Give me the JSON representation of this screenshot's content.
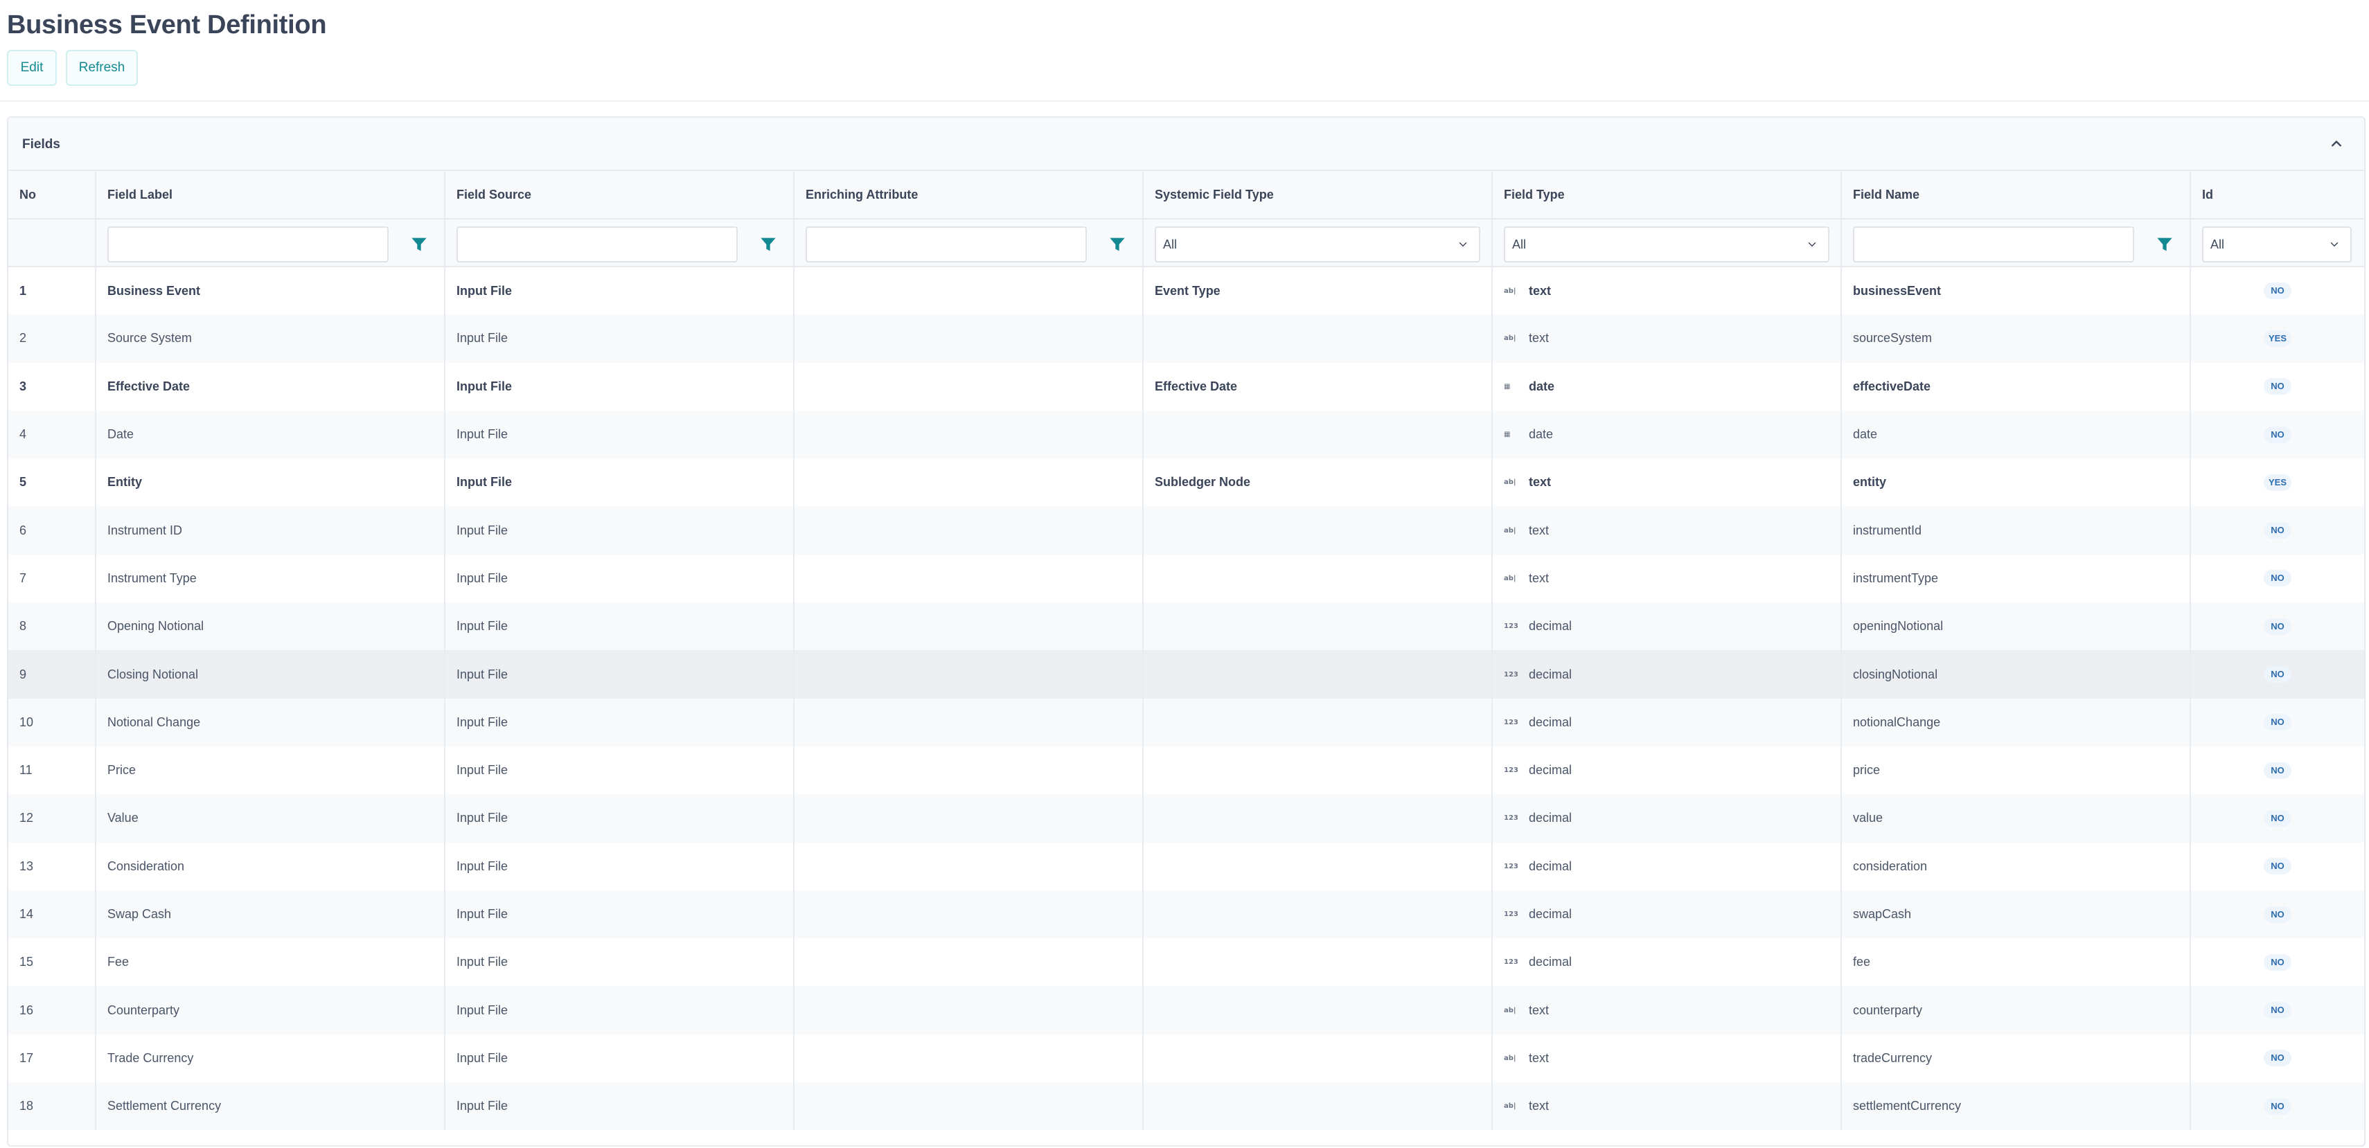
{
  "page": {
    "title": "Business Event Definition",
    "buttons": {
      "edit": "Edit",
      "refresh": "Refresh"
    }
  },
  "panel": {
    "title": "Fields",
    "collapse_icon": "chevron-up-icon"
  },
  "table": {
    "columns": [
      "No",
      "Field Label",
      "Field Source",
      "Enriching Attribute",
      "Systemic Field Type",
      "Field Type",
      "Field Name",
      "Id"
    ],
    "filters": {
      "field_label": "",
      "field_source": "",
      "enriching_attribute": "",
      "systemic_field_type": "All",
      "field_type": "All",
      "field_name": "",
      "id": "All"
    },
    "rows": [
      {
        "no": "1",
        "label": "Business Event",
        "source": "Input File",
        "enriching": "",
        "systemic": "Event Type",
        "type_icon": "ab|",
        "type": "text",
        "name": "businessEvent",
        "id": "NO",
        "bold": true
      },
      {
        "no": "2",
        "label": "Source System",
        "source": "Input File",
        "enriching": "",
        "systemic": "",
        "type_icon": "ab|",
        "type": "text",
        "name": "sourceSystem",
        "id": "YES",
        "bold": false
      },
      {
        "no": "3",
        "label": "Effective Date",
        "source": "Input File",
        "enriching": "",
        "systemic": "Effective Date",
        "type_icon": "▦",
        "type": "date",
        "name": "effectiveDate",
        "id": "NO",
        "bold": true
      },
      {
        "no": "4",
        "label": "Date",
        "source": "Input File",
        "enriching": "",
        "systemic": "",
        "type_icon": "▦",
        "type": "date",
        "name": "date",
        "id": "NO",
        "bold": false
      },
      {
        "no": "5",
        "label": "Entity",
        "source": "Input File",
        "enriching": "",
        "systemic": "Subledger Node",
        "type_icon": "ab|",
        "type": "text",
        "name": "entity",
        "id": "YES",
        "bold": true
      },
      {
        "no": "6",
        "label": "Instrument ID",
        "source": "Input File",
        "enriching": "",
        "systemic": "",
        "type_icon": "ab|",
        "type": "text",
        "name": "instrumentId",
        "id": "NO",
        "bold": false
      },
      {
        "no": "7",
        "label": "Instrument Type",
        "source": "Input File",
        "enriching": "",
        "systemic": "",
        "type_icon": "ab|",
        "type": "text",
        "name": "instrumentType",
        "id": "NO",
        "bold": false
      },
      {
        "no": "8",
        "label": "Opening Notional",
        "source": "Input File",
        "enriching": "",
        "systemic": "",
        "type_icon": "123",
        "type": "decimal",
        "name": "openingNotional",
        "id": "NO",
        "bold": false
      },
      {
        "no": "9",
        "label": "Closing Notional",
        "source": "Input File",
        "enriching": "",
        "systemic": "",
        "type_icon": "123",
        "type": "decimal",
        "name": "closingNotional",
        "id": "NO",
        "bold": false,
        "hover": true
      },
      {
        "no": "10",
        "label": "Notional Change",
        "source": "Input File",
        "enriching": "",
        "systemic": "",
        "type_icon": "123",
        "type": "decimal",
        "name": "notionalChange",
        "id": "NO",
        "bold": false
      },
      {
        "no": "11",
        "label": "Price",
        "source": "Input File",
        "enriching": "",
        "systemic": "",
        "type_icon": "123",
        "type": "decimal",
        "name": "price",
        "id": "NO",
        "bold": false
      },
      {
        "no": "12",
        "label": "Value",
        "source": "Input File",
        "enriching": "",
        "systemic": "",
        "type_icon": "123",
        "type": "decimal",
        "name": "value",
        "id": "NO",
        "bold": false
      },
      {
        "no": "13",
        "label": "Consideration",
        "source": "Input File",
        "enriching": "",
        "systemic": "",
        "type_icon": "123",
        "type": "decimal",
        "name": "consideration",
        "id": "NO",
        "bold": false
      },
      {
        "no": "14",
        "label": "Swap Cash",
        "source": "Input File",
        "enriching": "",
        "systemic": "",
        "type_icon": "123",
        "type": "decimal",
        "name": "swapCash",
        "id": "NO",
        "bold": false
      },
      {
        "no": "15",
        "label": "Fee",
        "source": "Input File",
        "enriching": "",
        "systemic": "",
        "type_icon": "123",
        "type": "decimal",
        "name": "fee",
        "id": "NO",
        "bold": false
      },
      {
        "no": "16",
        "label": "Counterparty",
        "source": "Input File",
        "enriching": "",
        "systemic": "",
        "type_icon": "ab|",
        "type": "text",
        "name": "counterparty",
        "id": "NO",
        "bold": false
      },
      {
        "no": "17",
        "label": "Trade Currency",
        "source": "Input File",
        "enriching": "",
        "systemic": "",
        "type_icon": "ab|",
        "type": "text",
        "name": "tradeCurrency",
        "id": "NO",
        "bold": false
      },
      {
        "no": "18",
        "label": "Settlement Currency",
        "source": "Input File",
        "enriching": "",
        "systemic": "",
        "type_icon": "ab|",
        "type": "text",
        "name": "settlementCurrency",
        "id": "NO",
        "bold": false
      }
    ]
  },
  "colors": {
    "accent": "#138a93",
    "badge_text": "#2c6cb0",
    "badge_bg": "#eef4fb",
    "heading": "#3b4559"
  }
}
